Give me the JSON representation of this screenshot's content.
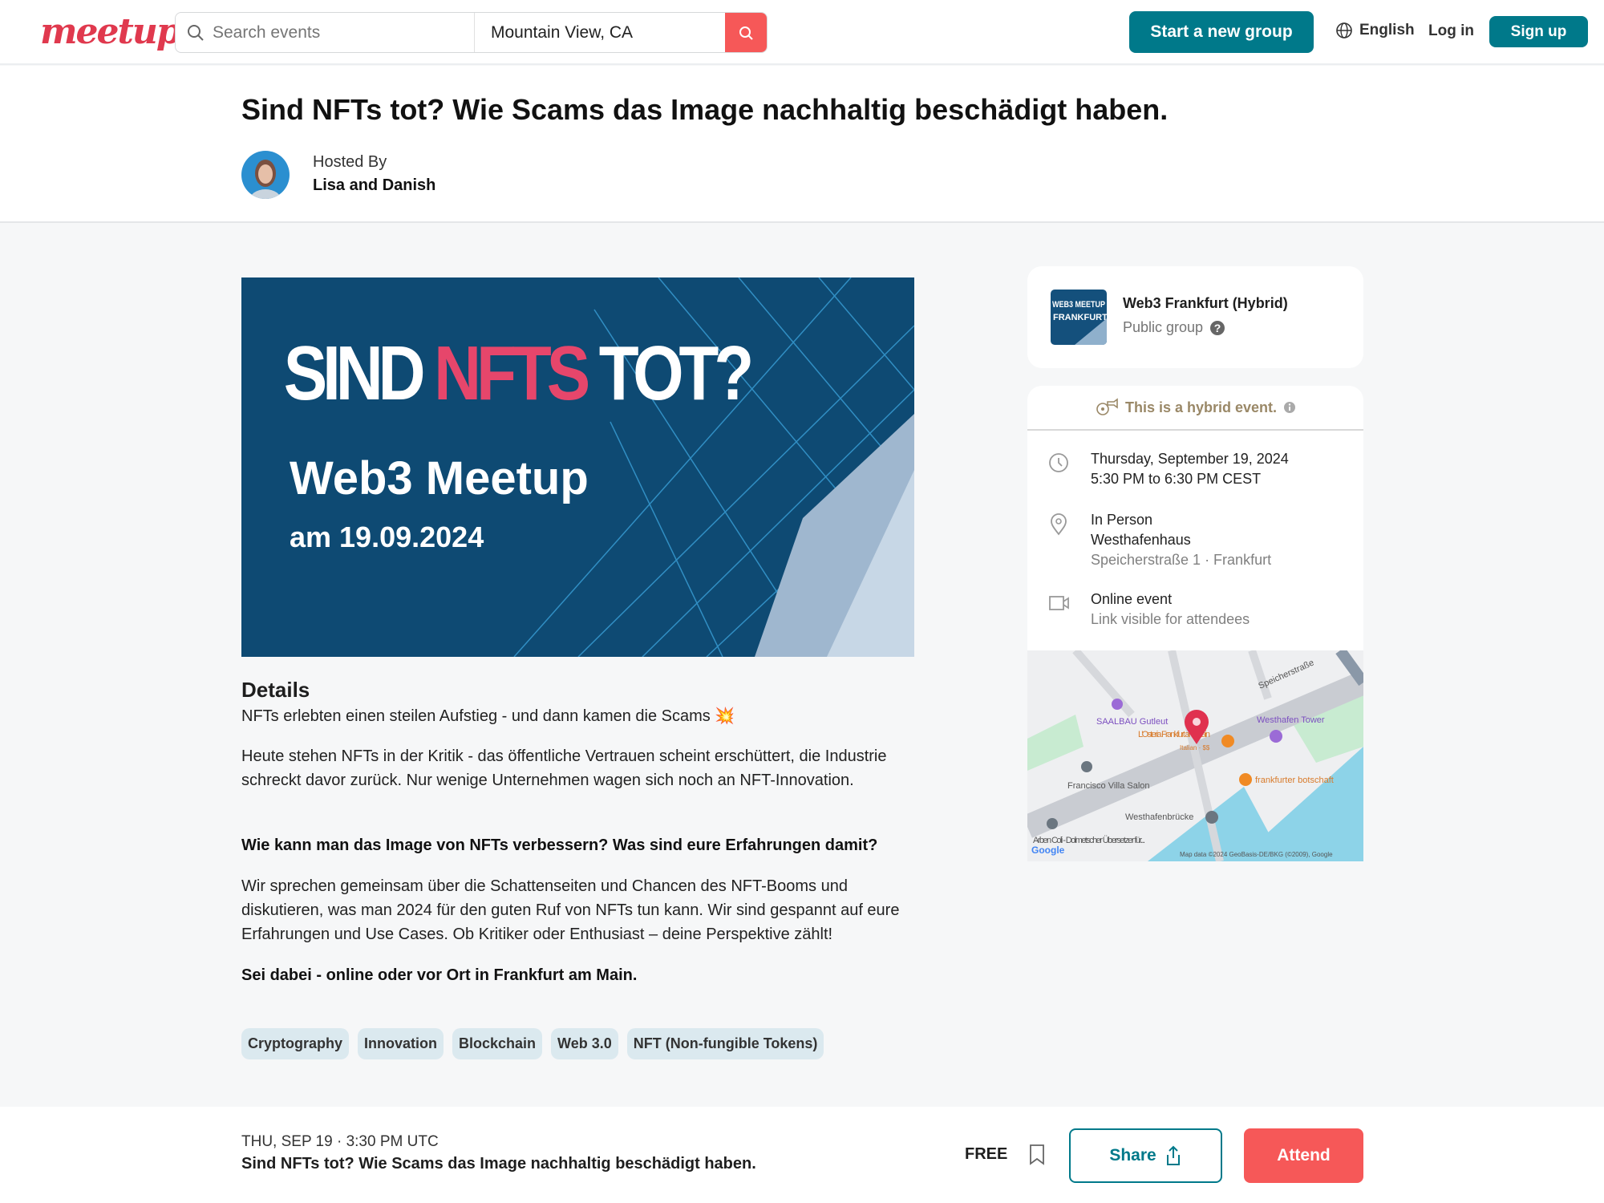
{
  "header": {
    "logo": "meetup",
    "search_placeholder": "Search events",
    "location_value": "Mountain View, CA",
    "start_group": "Start a new group",
    "language": "English",
    "login": "Log in",
    "signup": "Sign up"
  },
  "event": {
    "title": "Sind NFTs tot? Wie Scams das Image nachhaltig beschädigt haben.",
    "hosted_by_label": "Hosted By",
    "hosts": "Lisa and Danish"
  },
  "banner": {
    "line1_a": "SIND ",
    "line1_b": "NFTS",
    "line1_c": " TOT?",
    "line2": "Web3 Meetup",
    "line3": "am 19.09.2024"
  },
  "details": {
    "heading": "Details",
    "p1": "NFTs erlebten einen steilen Aufstieg - und dann kamen die Scams 💥",
    "p2": "Heute stehen NFTs in der Kritik - das öffentliche Vertrauen scheint erschüttert, die Industrie schreckt davor zurück. Nur wenige Unternehmen wagen sich noch an NFT-Innovation.",
    "p3": "Wie kann man das Image von NFTs verbessern? Was sind eure Erfahrungen damit?",
    "p4": "Wir sprechen gemeinsam über die Schattenseiten und Chancen des NFT-Booms und diskutieren, was man 2024 für den guten Ruf von NFTs tun kann. Wir sind gespannt auf eure Erfahrungen und Use Cases. Ob Kritiker oder Enthusiast – deine Perspektive zählt!",
    "p5": "Sei dabei - online oder vor Ort in Frankfurt am Main."
  },
  "tags": [
    "Cryptography",
    "Innovation",
    "Blockchain",
    "Web 3.0",
    "NFT (Non-fungible Tokens)"
  ],
  "group": {
    "name": "Web3 Frankfurt (Hybrid)",
    "type": "Public group",
    "thumb_text1": "WEB3 MEETUP",
    "thumb_text2": "FRANKFURT"
  },
  "info": {
    "hybrid": "This is a hybrid event.",
    "date": "Thursday, September 19, 2024",
    "time": "5:30 PM to 6:30 PM CEST",
    "in_person": "In Person",
    "venue": "Westhafenhaus",
    "address": "Speicherstraße 1 · Frankfurt",
    "online": "Online event",
    "online_note": "Link visible for attendees"
  },
  "map": {
    "street": "Speicherstraße",
    "poi1": "SAALBAU Gutleut",
    "poi2": "L'Osteria Frankfurt am Main",
    "poi2_sub": "Italian · $$",
    "poi3": "Westhafen Tower",
    "poi4": "Francisco Villa Salon",
    "poi5": "frankfurter botschaft",
    "poi6": "Westhafenbrücke",
    "poi7": "Arben Coli - Dolmetscher Übersetzer für...",
    "google": "Google",
    "attribution": "Map data ©2024 GeoBasis-DE/BKG (©2009), Google"
  },
  "bottom": {
    "date": "THU, SEP 19 · 3:30 PM UTC",
    "title": "Sind NFTs tot? Wie Scams das Image nachhaltig beschädigt haben.",
    "price": "FREE",
    "share": "Share",
    "attend": "Attend"
  },
  "colors": {
    "brand": "#f65858",
    "teal": "#00798a",
    "logo": "#e0394e"
  }
}
